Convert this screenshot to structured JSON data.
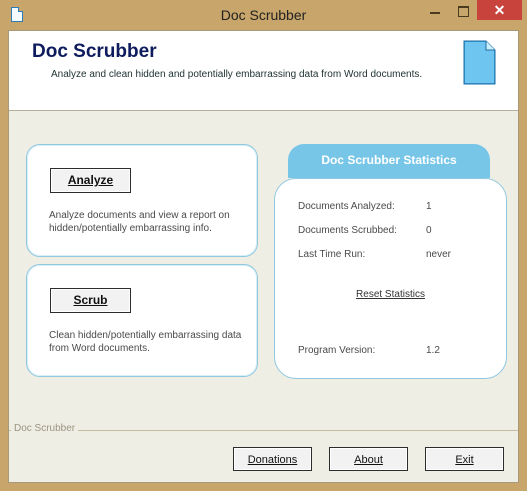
{
  "window": {
    "title": "Doc Scrubber"
  },
  "header": {
    "title": "Doc Scrubber",
    "subtitle": "Analyze and clean hidden and potentially embarrassing data from Word documents."
  },
  "analyze": {
    "button_label": "Analyze",
    "description": "Analyze documents and view a report on hidden/potentially embarrassing info."
  },
  "scrub": {
    "button_label": "Scrub",
    "description": "Clean hidden/potentially embarrassing data from Word documents."
  },
  "stats": {
    "title": "Doc Scrubber Statistics",
    "rows": [
      {
        "label": "Documents Analyzed:",
        "value": "1"
      },
      {
        "label": "Documents Scrubbed:",
        "value": "0"
      },
      {
        "label": "Last Time Run:",
        "value": "never"
      }
    ],
    "reset_label": "Reset Statistics",
    "version_label": "Program Version:",
    "version_value": "1.2"
  },
  "footer": {
    "group_label": "Doc Scrubber",
    "donations_label": "Donations",
    "about_label": "About",
    "exit_label": "Exit"
  },
  "colors": {
    "titlebar": "#c8a56a",
    "accent": "#78c6e7",
    "panel_border": "#8fc7df",
    "close": "#c7433b",
    "heading": "#0e1b5c"
  },
  "icons": {
    "app": "document-icon",
    "header": "document-icon"
  }
}
